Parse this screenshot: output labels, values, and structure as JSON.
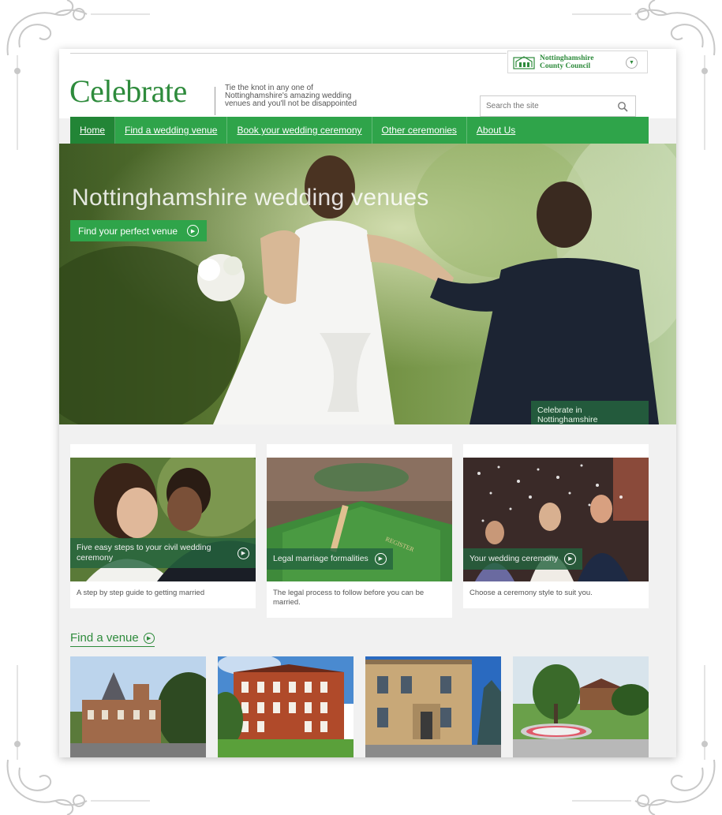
{
  "header": {
    "logo": "Celebrate",
    "tagline": "Tie the knot in any one of Nottinghamshire's amazing wedding venues and you'll not be disappointed",
    "council": {
      "line1": "Nottinghamshire",
      "line2": "County Council"
    },
    "search": {
      "placeholder": "Search the site"
    }
  },
  "nav": {
    "items": [
      {
        "label": "Home",
        "active": true
      },
      {
        "label": "Find a wedding venue"
      },
      {
        "label": "Book your wedding ceremony"
      },
      {
        "label": "Other ceremonies"
      },
      {
        "label": "About Us"
      }
    ]
  },
  "hero": {
    "title": "Nottinghamshire wedding venues",
    "button": "Find your perfect venue",
    "caption": "Celebrate in Nottinghamshire"
  },
  "cards": [
    {
      "label": "Five easy steps to your civil wedding ceremony",
      "description": "A step by step guide to getting married"
    },
    {
      "label": "Legal marriage formalities",
      "description": "The legal process to follow before you can be married."
    },
    {
      "label": "Your wedding ceremony",
      "description": "Choose a ceremony style to suit you."
    }
  ],
  "find_venue": {
    "label": "Find a venue"
  },
  "colors": {
    "brand_green": "#2fa44a",
    "dark_green": "#24643e"
  },
  "icons": {
    "search": "search-icon",
    "play": "play-circle-icon",
    "dropdown": "chevron-down-icon"
  }
}
